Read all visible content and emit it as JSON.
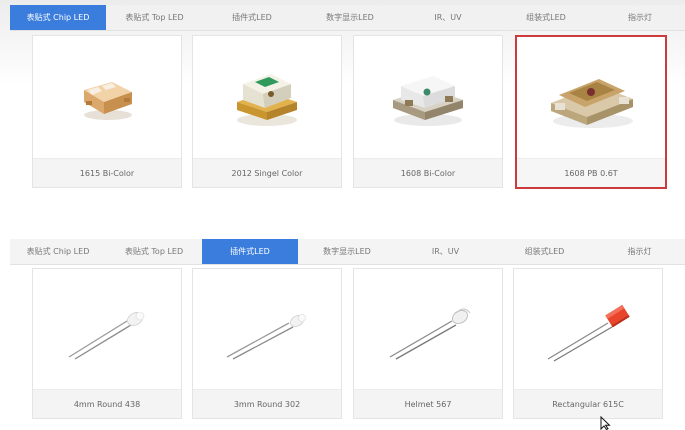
{
  "tabs_top": [
    {
      "label": "表贴式 Chip LED",
      "active": true
    },
    {
      "label": "表贴式 Top LED",
      "active": false
    },
    {
      "label": "插件式LED",
      "active": false
    },
    {
      "label": "数字显示LED",
      "active": false
    },
    {
      "label": "IR、UV",
      "active": false
    },
    {
      "label": "组装式LED",
      "active": false
    },
    {
      "label": "指示灯",
      "active": false
    }
  ],
  "products_top": [
    {
      "name": "1615 Bi-Color",
      "icon": "chip-led-bicolor-icon"
    },
    {
      "name": "2012 Singel Color",
      "icon": "chip-led-green-icon"
    },
    {
      "name": "1608 Bi-Color",
      "icon": "chip-led-clear-icon"
    },
    {
      "name": "1608 PB 0.6T",
      "icon": "chip-led-amber-icon",
      "selected": true
    }
  ],
  "tabs_bottom": [
    {
      "label": "表贴式 Chip LED",
      "active": false
    },
    {
      "label": "表贴式 Top LED",
      "active": false
    },
    {
      "label": "插件式LED",
      "active": true
    },
    {
      "label": "数字显示LED",
      "active": false
    },
    {
      "label": "IR、UV",
      "active": false
    },
    {
      "label": "组装式LED",
      "active": false
    },
    {
      "label": "指示灯",
      "active": false
    }
  ],
  "products_bottom": [
    {
      "name": "4mm Round 438",
      "icon": "round-led-clear-icon"
    },
    {
      "name": "3mm Round 302",
      "icon": "round-led-clear-icon"
    },
    {
      "name": "Helmet 567",
      "icon": "helmet-led-icon"
    },
    {
      "name": "Rectangular 615C",
      "icon": "rectangular-led-red-icon"
    }
  ],
  "colors": {
    "accent": "#3b7ddd",
    "selected_border": "#cc3b3b",
    "led_red": "#e8452c"
  }
}
